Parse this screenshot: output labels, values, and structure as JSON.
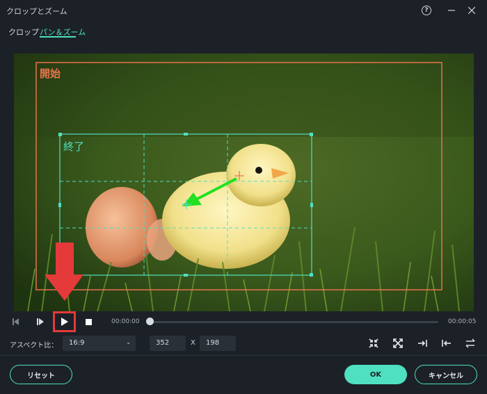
{
  "window": {
    "title": "クロップとズーム",
    "help_icon": "help-circle-icon",
    "minimize_icon": "minimize-icon",
    "close_icon": "close-icon"
  },
  "tabs": [
    {
      "label": "クロップ",
      "active": false
    },
    {
      "label": "パン＆ズーム",
      "active": true
    }
  ],
  "preview": {
    "start_label": "開始",
    "end_label": "終了",
    "start_color": "#e8734a",
    "end_color": "#4fe0c1",
    "arrow_color": "#22e022"
  },
  "playback": {
    "current_time": "00:00:00",
    "total_time": "00:00:05",
    "progress": 0
  },
  "settings": {
    "aspect_label": "アスペクト比：",
    "aspect_value": "16:9",
    "width": "352",
    "separator": "X",
    "height": "198"
  },
  "tools": [
    "fit-icon",
    "fill-icon",
    "align-right-icon",
    "align-left-icon",
    "swap-icon"
  ],
  "buttons": {
    "reset": "リセット",
    "ok": "OK",
    "cancel": "キャンセル"
  },
  "colors": {
    "accent": "#4fe0c1",
    "background": "#1c2127",
    "annotation": "#e53a3a"
  }
}
